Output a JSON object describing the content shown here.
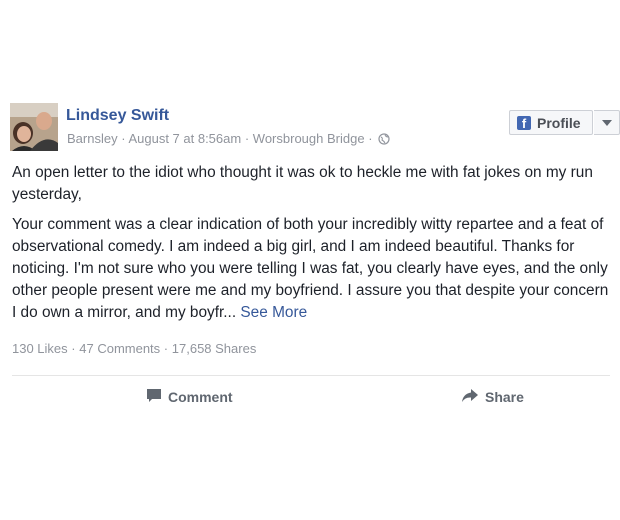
{
  "post": {
    "author": "Lindsey Swift",
    "location": "Barnsley",
    "timestamp": "August 7 at 8:56am",
    "place": "Worsbrough Bridge",
    "separator": "·",
    "privacy_icon": "globe-icon",
    "paragraphs": [
      "An open letter to the idiot who thought it was ok to heckle me with fat jokes on my run yesterday,",
      "Your comment was a clear indication of both your incredibly witty repartee and a feat of observational comedy. I am indeed a big girl, and I am indeed beautiful. Thanks for noticing. I'm not sure who you were telling I was fat, you clearly have eyes, and the only other people present were me and my boyfriend. I assure you that despite your concern I do own a mirror, and my boyfr..."
    ],
    "see_more": "See More",
    "stats": {
      "likes": "130 Likes",
      "comments": "47 Comments",
      "shares": "17,658 Shares"
    }
  },
  "profile_button": {
    "label": "Profile",
    "icon": "facebook-f-icon"
  },
  "actions": {
    "comment": "Comment",
    "share": "Share"
  },
  "colors": {
    "link": "#365899",
    "meta": "#90949c",
    "text": "#1d2129"
  }
}
